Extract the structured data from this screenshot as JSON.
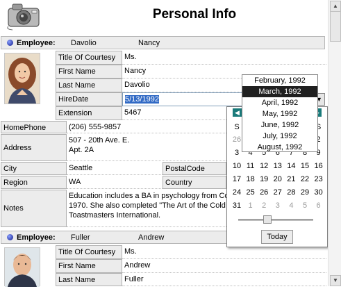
{
  "header": {
    "title": "Personal Info"
  },
  "employees": [
    {
      "label": "Employee:",
      "first": "Davolio",
      "last": "Nancy",
      "fields": {
        "title_of_courtesy": {
          "label": "Title Of Courtesy",
          "value": "Ms."
        },
        "first_name": {
          "label": "First Name",
          "value": "Nancy"
        },
        "last_name": {
          "label": "Last Name",
          "value": "Davolio"
        },
        "hire_date": {
          "label": "HireDate",
          "value": "5/13/1992"
        },
        "extension": {
          "label": "Extension",
          "value": "5467"
        },
        "home_phone": {
          "label": "HomePhone",
          "value": "(206) 555-9857"
        },
        "address": {
          "label": "Address",
          "line1": "507 - 20th Ave. E.",
          "line2": "Apt. 2A"
        },
        "city": {
          "label": "City",
          "value": "Seattle"
        },
        "postal_code": {
          "label": "PostalCode",
          "value": ""
        },
        "region": {
          "label": "Region",
          "value": "WA"
        },
        "country": {
          "label": "Country",
          "value": ""
        },
        "notes": {
          "label": "Notes",
          "line1": "Education includes a BA in psychology from Co",
          "line2": "1970.  She also completed \"The Art of the Cold",
          "line3": "Toastmasters International."
        }
      }
    },
    {
      "label": "Employee:",
      "first": "Fuller",
      "last": "Andrew",
      "fields": {
        "title_of_courtesy": {
          "label": "Title Of Courtesy",
          "value": "Ms."
        },
        "first_name": {
          "label": "First Name",
          "value": "Andrew"
        },
        "last_name": {
          "label": "Last Name",
          "value": "Fuller"
        }
      }
    }
  ],
  "month_dropdown": {
    "items": [
      "February, 1992",
      "March, 1992",
      "April, 1992",
      "May, 1992",
      "June, 1992",
      "July, 1992",
      "August, 1992"
    ],
    "selected_index": 1
  },
  "calendar": {
    "prev_icon": "left-arrow-icon",
    "next_icon": "right-arrow-icon",
    "weekday_headers": [
      "S",
      "",
      "",
      "",
      "",
      "",
      "S"
    ],
    "header_row": [
      "S",
      "S"
    ],
    "rows": [
      [
        "26",
        "",
        "",
        "",
        "",
        "",
        "2"
      ],
      [
        "3",
        "4",
        "5",
        "6",
        "7",
        "8",
        "9"
      ],
      [
        "10",
        "11",
        "12",
        "13",
        "14",
        "15",
        "16"
      ],
      [
        "17",
        "18",
        "19",
        "20",
        "21",
        "22",
        "23"
      ],
      [
        "24",
        "25",
        "26",
        "27",
        "28",
        "29",
        "30"
      ],
      [
        "31",
        "1",
        "2",
        "3",
        "4",
        "5",
        "6"
      ]
    ],
    "today_label": "Today"
  },
  "colors": {
    "accent": "#316ac5",
    "nav_button": "#1a7a7a",
    "selected_month": "#202020"
  }
}
